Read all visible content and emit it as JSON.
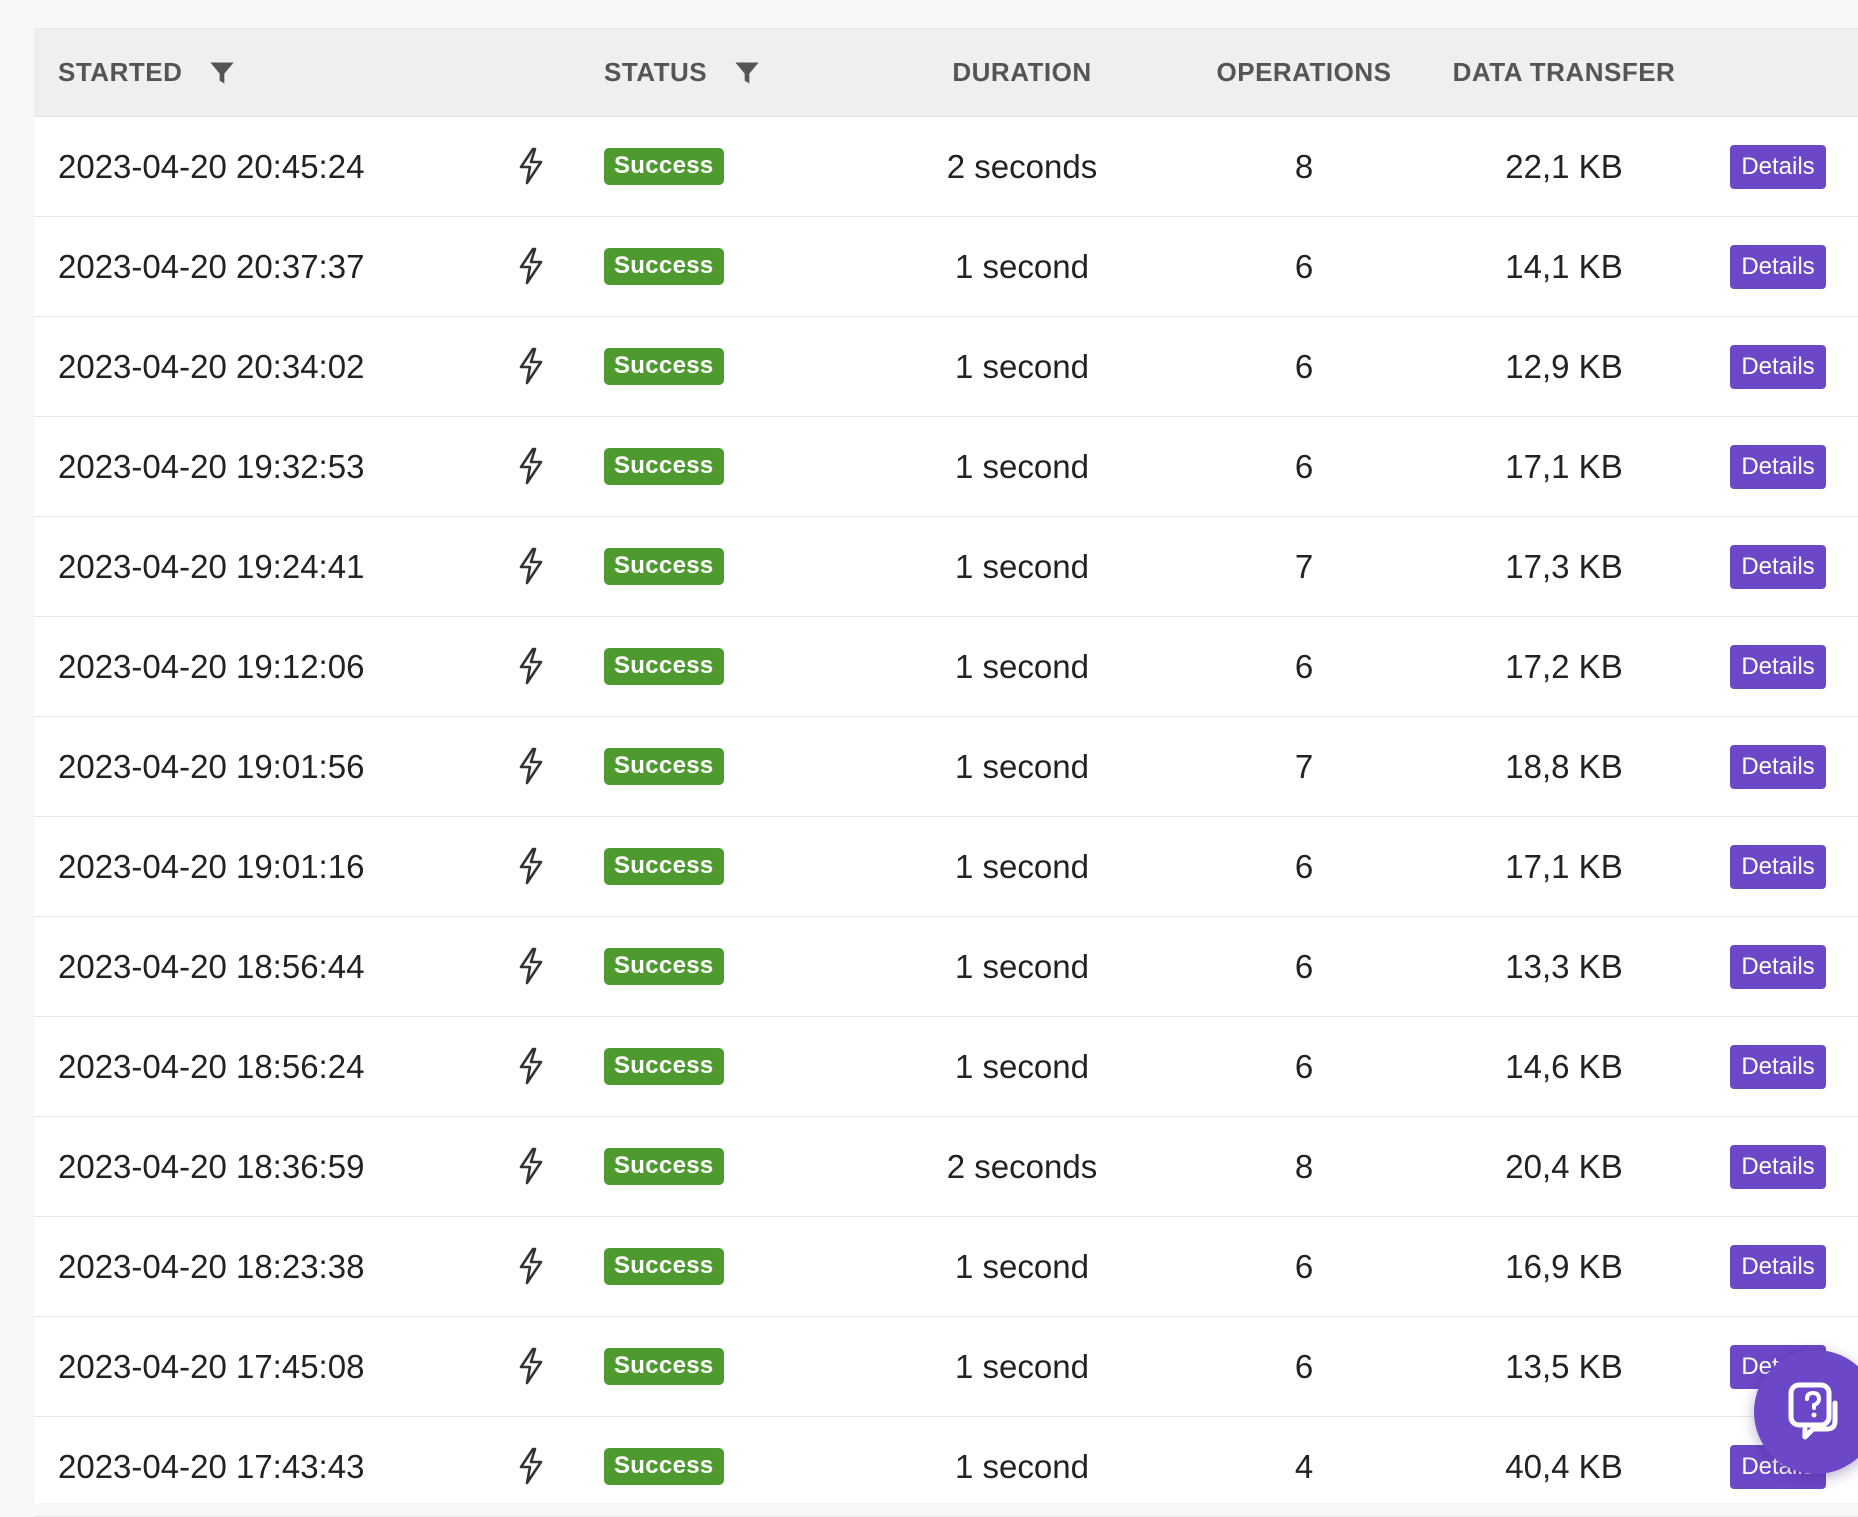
{
  "columns": {
    "started": "STARTED",
    "status": "STATUS",
    "duration": "DURATION",
    "operations": "OPERATIONS",
    "data_transfer": "DATA TRANSFER"
  },
  "details_label": "Details",
  "rows": [
    {
      "started": "2023-04-20 20:45:24",
      "status": "Success",
      "duration": "2 seconds",
      "operations": "8",
      "data": "22,1 KB"
    },
    {
      "started": "2023-04-20 20:37:37",
      "status": "Success",
      "duration": "1 second",
      "operations": "6",
      "data": "14,1 KB"
    },
    {
      "started": "2023-04-20 20:34:02",
      "status": "Success",
      "duration": "1 second",
      "operations": "6",
      "data": "12,9 KB"
    },
    {
      "started": "2023-04-20 19:32:53",
      "status": "Success",
      "duration": "1 second",
      "operations": "6",
      "data": "17,1 KB"
    },
    {
      "started": "2023-04-20 19:24:41",
      "status": "Success",
      "duration": "1 second",
      "operations": "7",
      "data": "17,3 KB"
    },
    {
      "started": "2023-04-20 19:12:06",
      "status": "Success",
      "duration": "1 second",
      "operations": "6",
      "data": "17,2 KB"
    },
    {
      "started": "2023-04-20 19:01:56",
      "status": "Success",
      "duration": "1 second",
      "operations": "7",
      "data": "18,8 KB"
    },
    {
      "started": "2023-04-20 19:01:16",
      "status": "Success",
      "duration": "1 second",
      "operations": "6",
      "data": "17,1 KB"
    },
    {
      "started": "2023-04-20 18:56:44",
      "status": "Success",
      "duration": "1 second",
      "operations": "6",
      "data": "13,3 KB"
    },
    {
      "started": "2023-04-20 18:56:24",
      "status": "Success",
      "duration": "1 second",
      "operations": "6",
      "data": "14,6 KB"
    },
    {
      "started": "2023-04-20 18:36:59",
      "status": "Success",
      "duration": "2 seconds",
      "operations": "8",
      "data": "20,4 KB"
    },
    {
      "started": "2023-04-20 18:23:38",
      "status": "Success",
      "duration": "1 second",
      "operations": "6",
      "data": "16,9 KB"
    },
    {
      "started": "2023-04-20 17:45:08",
      "status": "Success",
      "duration": "1 second",
      "operations": "6",
      "data": "13,5 KB"
    },
    {
      "started": "2023-04-20 17:43:43",
      "status": "Success",
      "duration": "1 second",
      "operations": "4",
      "data": "40,4 KB"
    }
  ],
  "icons": {
    "filter": "filter-icon",
    "trigger": "lightning-bolt-icon",
    "help": "help-chat-icon"
  },
  "colors": {
    "success_badge": "#4f9a2f",
    "details_button": "#6c47c7",
    "header_bg": "#efefef"
  }
}
